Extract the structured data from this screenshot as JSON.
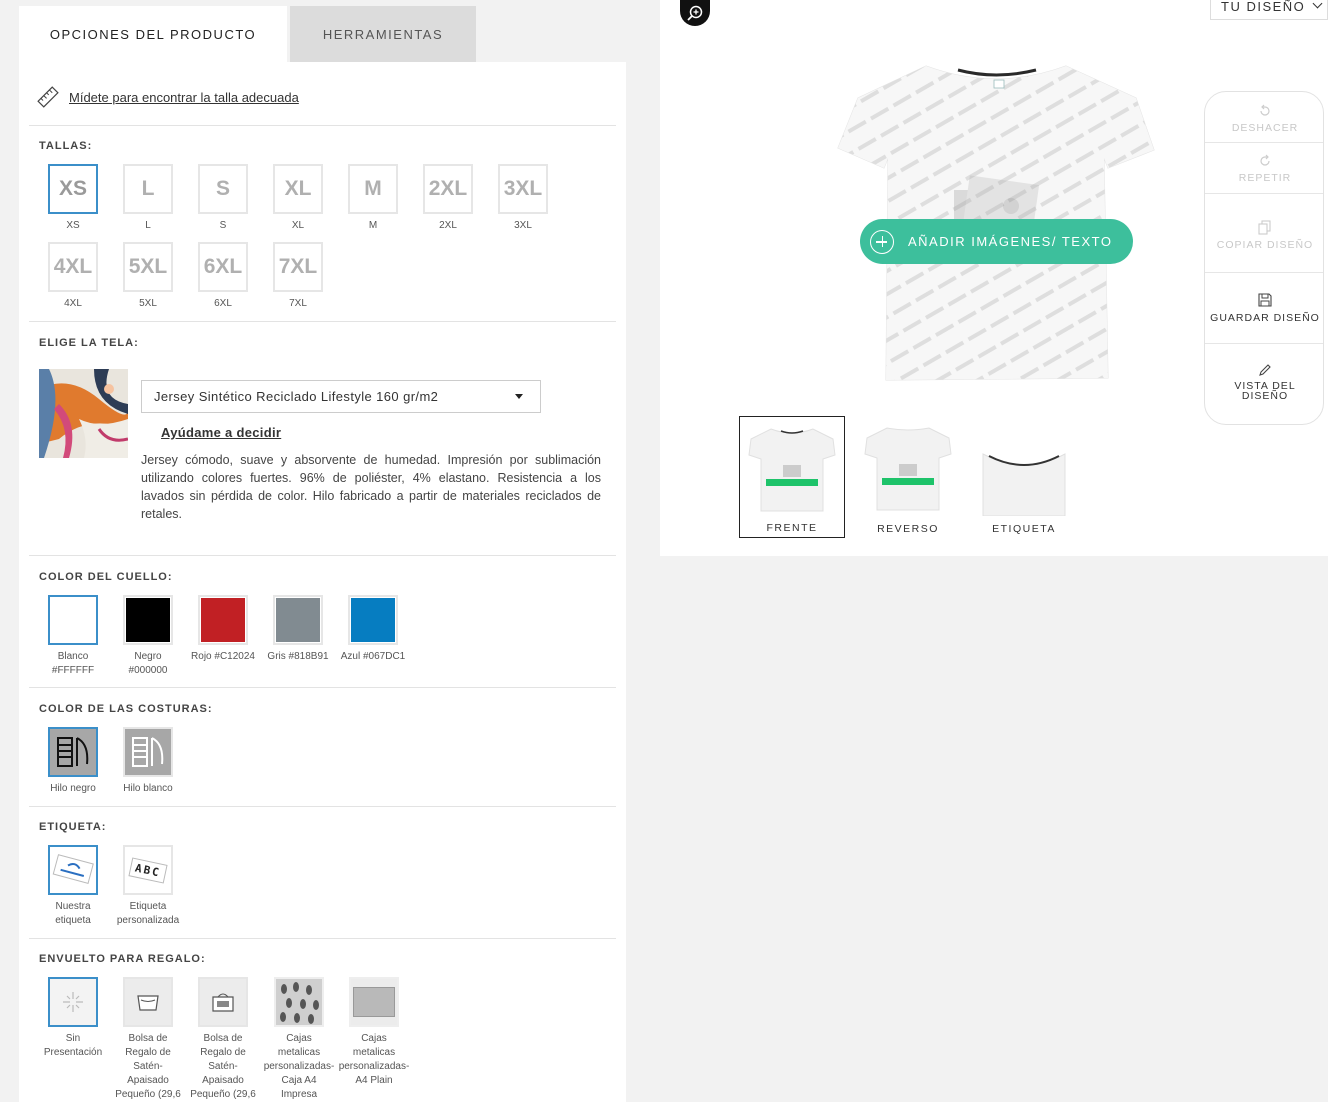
{
  "tabs": {
    "product_options": "OPCIONES DEL PRODUCTO",
    "tools": "HERRAMIENTAS"
  },
  "measure_link": "Mídete para encontrar la talla adecuada",
  "sizes": {
    "title": "TALLAS:",
    "items": [
      "XS",
      "L",
      "S",
      "XL",
      "M",
      "2XL",
      "3XL",
      "4XL",
      "5XL",
      "6XL",
      "7XL"
    ],
    "selected": "XS"
  },
  "fabric": {
    "title": "ELIGE LA TELA:",
    "selected": "Jersey Sintético Reciclado Lifestyle 160 gr/m2",
    "help_link": "Ayúdame a decidir",
    "description": "Jersey cómodo, suave y absorvente de humedad. Impresión por sublimación utilizando colores fuertes. 96% de poliéster, 4% elastano. Resistencia a los lavados sin pérdida de color. Hilo fabricado a partir de materiales reciclados de retales."
  },
  "collar_color": {
    "title": "COLOR DEL CUELLO:",
    "items": [
      {
        "label_line1": "Blanco",
        "label_line2": "#FFFFFF",
        "color": "#FFFFFF"
      },
      {
        "label_line1": "Negro",
        "label_line2": "#000000",
        "color": "#000000"
      },
      {
        "label_line1": "Rojo #C12024",
        "label_line2": "",
        "color": "#C12024"
      },
      {
        "label_line1": "Gris #818B91",
        "label_line2": "",
        "color": "#818B91"
      },
      {
        "label_line1": "Azul #067DC1",
        "label_line2": "",
        "color": "#067DC1"
      }
    ]
  },
  "seam_color": {
    "title": "COLOR DE LAS COSTURAS:",
    "items": [
      {
        "label": "Hilo negro"
      },
      {
        "label": "Hilo blanco"
      }
    ]
  },
  "label": {
    "title": "ETIQUETA:",
    "items": [
      {
        "line1": "Nuestra",
        "line2": "etiqueta"
      },
      {
        "line1": "Etiqueta",
        "line2": "personalizada"
      }
    ],
    "custom_label_text": "ABC"
  },
  "gift": {
    "title": "ENVUELTO PARA REGALO:",
    "items": [
      {
        "lines": [
          "Sin",
          "Presentación"
        ]
      },
      {
        "lines": [
          "Bolsa de",
          "Regalo de",
          "Satén-",
          "Apaisado",
          "Pequeño (29,6"
        ]
      },
      {
        "lines": [
          "Bolsa de",
          "Regalo de",
          "Satén-",
          "Apaisado",
          "Pequeño (29,6"
        ]
      },
      {
        "lines": [
          "Cajas",
          "metalicas",
          "personalizadas-",
          "Caja A4",
          "Impresa"
        ]
      },
      {
        "lines": [
          "Cajas",
          "metalicas",
          "personalizadas-",
          "A4 Plain"
        ]
      }
    ]
  },
  "design_dropdown": "TU DISEÑO",
  "add_button": "AÑADIR IMÁGENES/ TEXTO",
  "tools_panel": {
    "undo": "DESHACER",
    "redo": "REPETIR",
    "copy_line1": "COPIAR DISEÑO",
    "save": "GUARDAR DISEÑO",
    "preview_line1": "VISTA DEL",
    "preview_line2": "DISEÑO"
  },
  "views": [
    "FRENTE",
    "REVERSO",
    "ETIQUETA"
  ],
  "colors": {
    "accent": "#3DBF9C",
    "selected_border": "#3B8FC9"
  }
}
